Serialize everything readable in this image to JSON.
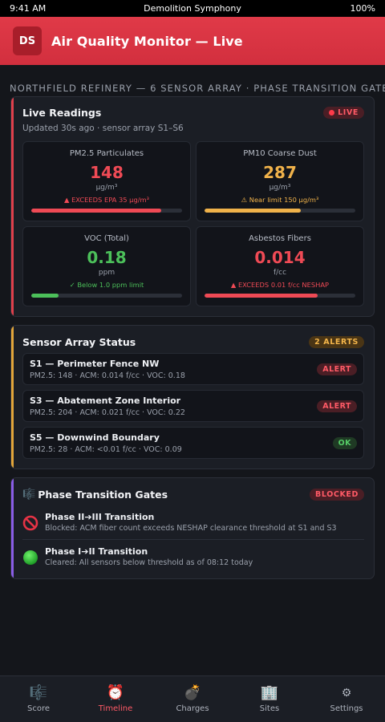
{
  "status_bar": {
    "time": "9:41 AM",
    "title": "Demolition Symphony",
    "battery": "100%"
  },
  "header": {
    "logo": "DS",
    "title": "Air Quality Monitor — Live"
  },
  "site_label": "NORTHFIELD REFINERY — 6 SENSOR ARRAY · PHASE TRANSITION GATE",
  "live": {
    "title": "Live Readings",
    "badge": "LIVE",
    "updated": "Updated 30s ago · sensor array S1–S6",
    "readings": [
      {
        "label": "PM2.5 Particulates",
        "value": "148",
        "unit": "µg/m³",
        "note": "▲ EXCEEDS EPA 35 µg/m³",
        "color": "#ef4a55",
        "level": 0.86
      },
      {
        "label": "PM10 Coarse Dust",
        "value": "287",
        "unit": "µg/m³",
        "note": "⚠ Near limit 150 µg/m³",
        "color": "#f0b24a",
        "level": 0.64
      },
      {
        "label": "VOC (Total)",
        "value": "0.18",
        "unit": "ppm",
        "note": "✓ Below 1.0 ppm limit",
        "color": "#4cc05a",
        "level": 0.18
      },
      {
        "label": "Asbestos Fibers",
        "value": "0.014",
        "unit": "f/cc",
        "note": "▲ EXCEEDS 0.01 f/cc NESHAP",
        "color": "#ef4a55",
        "level": 0.75
      }
    ]
  },
  "sensors": {
    "title": "Sensor Array Status",
    "badge": "2 ALERTS",
    "items": [
      {
        "name": "S1 — Perimeter Fence NW",
        "meta": "PM2.5: 148 · ACM: 0.014 f/cc · VOC: 0.18",
        "status": "ALERT"
      },
      {
        "name": "S3 — Abatement Zone Interior",
        "meta": "PM2.5: 204 · ACM: 0.021 f/cc · VOC: 0.22",
        "status": "ALERT"
      },
      {
        "name": "S5 — Downwind Boundary",
        "meta": "PM2.5: 28 · ACM: <0.01 f/cc · VOC: 0.09",
        "status": "OK"
      }
    ]
  },
  "gates": {
    "title": "Phase Transition Gates",
    "badge": "BLOCKED",
    "items": [
      {
        "title": "Phase II➔III Transition",
        "desc": "Blocked: ACM fiber count exceeds NESHAP clearance threshold at S1 and S3"
      },
      {
        "title": "Phase I➔II Transition",
        "desc": "Cleared: All sensors below threshold as of 08:12 today"
      }
    ]
  },
  "tabs": [
    {
      "label": "Score",
      "icon": "🎼"
    },
    {
      "label": "Timeline",
      "icon": "⏰"
    },
    {
      "label": "Charges",
      "icon": "💣"
    },
    {
      "label": "Sites",
      "icon": "🏢"
    },
    {
      "label": "Settings",
      "icon": "⚙"
    }
  ]
}
